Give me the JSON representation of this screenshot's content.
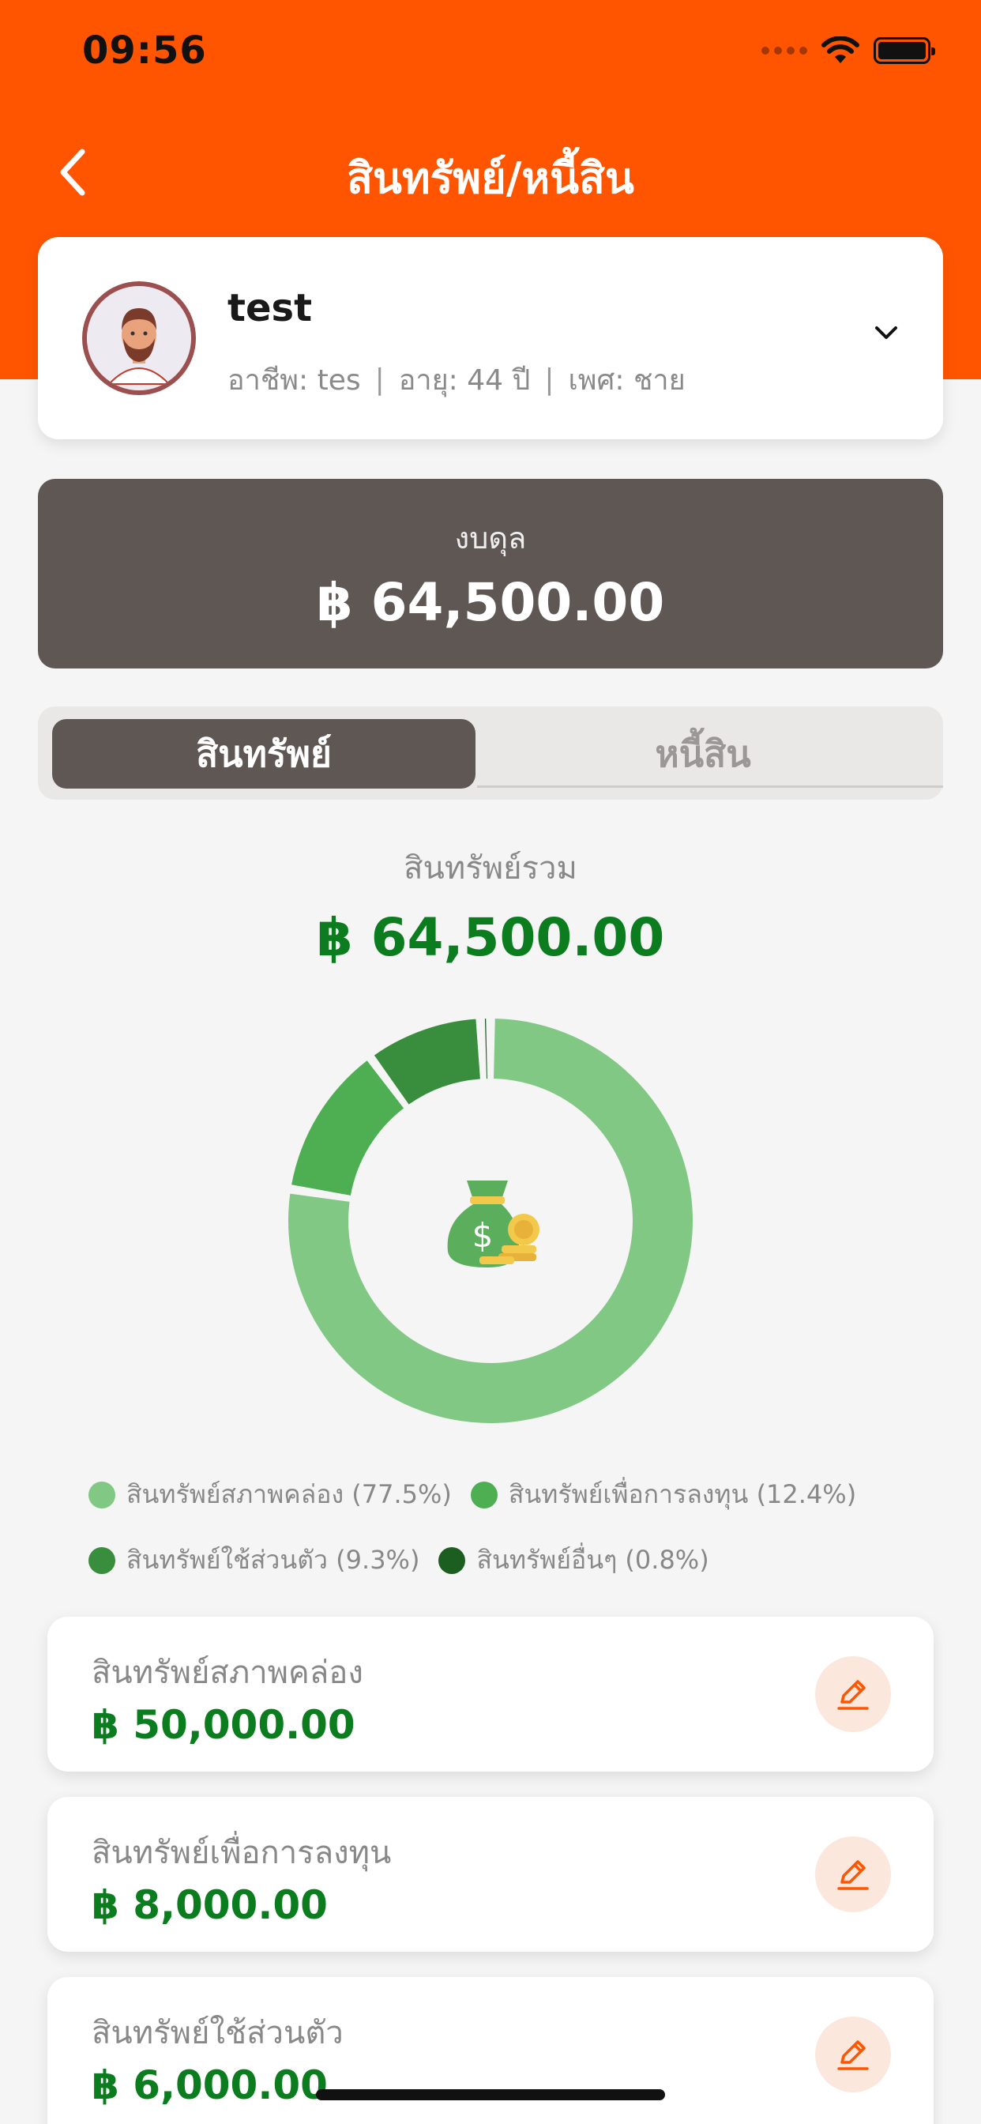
{
  "status_bar": {
    "time": "09:56"
  },
  "header": {
    "title": "สินทรัพย์/หนี้สิน"
  },
  "profile": {
    "name": "test",
    "occupation": "อาชีพ: tes",
    "age": "อายุ: 44 ปี",
    "gender": "เพศ: ชาย",
    "separator": "|"
  },
  "balance": {
    "label": "งบดุล",
    "value": "฿ 64,500.00"
  },
  "tabs": [
    {
      "label": "สินทรัพย์",
      "active": true
    },
    {
      "label": "หนี้สิน",
      "active": false
    }
  ],
  "summary": {
    "label": "สินทรัพย์รวม",
    "value": "฿ 64,500.00"
  },
  "chart_data": {
    "type": "pie",
    "categories": [
      "สินทรัพย์สภาพคล่อง",
      "สินทรัพย์เพื่อการลงทุน",
      "สินทรัพย์ใช้ส่วนตัว",
      "สินทรัพย์อื่นๆ"
    ],
    "values": [
      77.5,
      12.4,
      9.3,
      0.8
    ],
    "colors": [
      "#80C883",
      "#4DAE52",
      "#388E3C",
      "#1B5E20"
    ],
    "legend": [
      {
        "label": "สินทรัพย์สภาพคล่อง (77.5%)",
        "color": "#80C883"
      },
      {
        "label": "สินทรัพย์เพื่อการลงทุน (12.4%)",
        "color": "#4DAE52"
      },
      {
        "label": "สินทรัพย์ใช้ส่วนตัว (9.3%)",
        "color": "#388E3C"
      },
      {
        "label": "สินทรัพย์อื่นๆ (0.8%)",
        "color": "#1B5E20"
      }
    ]
  },
  "asset_items": [
    {
      "label": "สินทรัพย์สภาพคล่อง",
      "value": "฿ 50,000.00"
    },
    {
      "label": "สินทรัพย์เพื่อการลงทุน",
      "value": "฿ 8,000.00"
    },
    {
      "label": "สินทรัพย์ใช้ส่วนตัว",
      "value": "฿ 6,000.00"
    }
  ],
  "colors": {
    "brand": "#FF5500",
    "dark": "#5E5754",
    "money": "#0B7D1E"
  },
  "icons": {
    "back": "chevron-left-icon",
    "expand": "chevron-down-icon",
    "edit": "pencil-icon",
    "center": "money-bag-icon"
  }
}
